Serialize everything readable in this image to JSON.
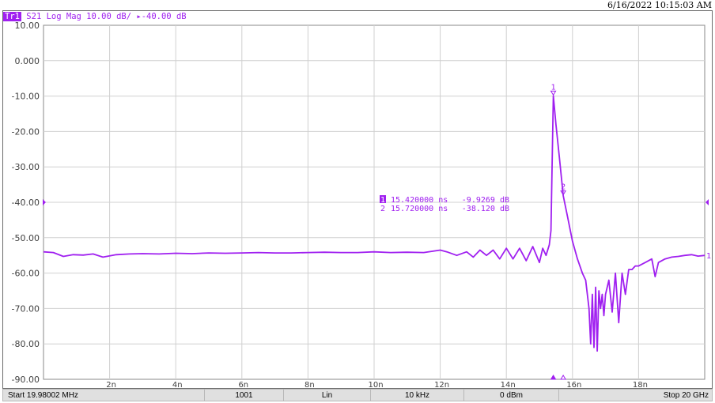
{
  "timestamp": "6/16/2022 10:15:03 AM",
  "trace": {
    "badge": "Tr1",
    "label": "S21 Log Mag 10.00 dB/ ▸-40.00 dB",
    "color": "#a020f0"
  },
  "status": {
    "start": "Start 19.98002 MHz",
    "points": "1001",
    "sweep_type": "Lin",
    "ifbw": "10 kHz",
    "power": "0 dBm",
    "stop": "Stop 20 GHz"
  },
  "markers": [
    {
      "id": "1",
      "x": 15.42,
      "y": -9.9269,
      "x_text": "15.420000 ns",
      "y_text": "-9.9269 dB",
      "active": true
    },
    {
      "id": "2",
      "x": 15.72,
      "y": -38.12,
      "x_text": "15.720000 ns",
      "y_text": "-38.120 dB",
      "active": false
    }
  ],
  "chart_data": {
    "type": "line",
    "title": "S21 Log Mag 10.00 dB/ ▸-40.00 dB",
    "xlabel": "",
    "ylabel": "",
    "xlim": [
      0,
      20
    ],
    "ylim": [
      -90,
      10
    ],
    "grid": true,
    "reference_level": -40,
    "y_ticks": [
      "10.00",
      "0.000",
      "-10.00",
      "-20.00",
      "-30.00",
      "-40.00",
      "-50.00",
      "-60.00",
      "-70.00",
      "-80.00",
      "-90.00"
    ],
    "x_ticks": [
      "2n",
      "4n",
      "6n",
      "8n",
      "10n",
      "12n",
      "14n",
      "16n",
      "18n"
    ],
    "x_tick_values": [
      2,
      4,
      6,
      8,
      10,
      12,
      14,
      16,
      18
    ],
    "series": [
      {
        "color": "#a020f0",
        "x": [
          0,
          0.3,
          0.6,
          0.9,
          1.2,
          1.5,
          1.8,
          2.2,
          2.6,
          3.0,
          3.5,
          4.0,
          4.5,
          5.0,
          5.5,
          6.0,
          6.5,
          7.0,
          7.5,
          8.0,
          8.5,
          9.0,
          9.5,
          10.0,
          10.5,
          11.0,
          11.5,
          12.0,
          12.2,
          12.5,
          12.8,
          13.0,
          13.2,
          13.4,
          13.6,
          13.8,
          14.0,
          14.2,
          14.4,
          14.6,
          14.8,
          15.0,
          15.1,
          15.2,
          15.3,
          15.35,
          15.42,
          15.5,
          15.6,
          15.72,
          15.85,
          16.0,
          16.15,
          16.3,
          16.4,
          16.5,
          16.55,
          16.6,
          16.65,
          16.7,
          16.75,
          16.8,
          16.85,
          16.9,
          16.95,
          17.0,
          17.1,
          17.2,
          17.3,
          17.4,
          17.5,
          17.6,
          17.7,
          17.8,
          17.9,
          18.0,
          18.2,
          18.4,
          18.5,
          18.6,
          18.8,
          19.0,
          19.2,
          19.4,
          19.6,
          19.8,
          20.0
        ],
        "y": [
          -54,
          -54.2,
          -55.3,
          -54.8,
          -54.9,
          -54.6,
          -55.5,
          -54.8,
          -54.6,
          -54.5,
          -54.6,
          -54.4,
          -54.5,
          -54.3,
          -54.4,
          -54.3,
          -54.2,
          -54.3,
          -54.3,
          -54.2,
          -54.1,
          -54.2,
          -54.2,
          -54.0,
          -54.2,
          -54.1,
          -54.2,
          -53.5,
          -54.0,
          -55.0,
          -54.0,
          -55.5,
          -53.5,
          -55.0,
          -53.5,
          -56.0,
          -53.0,
          -56.0,
          -53.0,
          -56.5,
          -52.5,
          -57.0,
          -53.0,
          -55.0,
          -52.0,
          -48.0,
          -9.9269,
          -18.0,
          -27.0,
          -38.12,
          -44.0,
          -51.0,
          -56.0,
          -60.0,
          -62.0,
          -70.0,
          -80.0,
          -66.0,
          -81.0,
          -64.0,
          -82.0,
          -65.0,
          -70.0,
          -66.0,
          -72.0,
          -66.0,
          -62.0,
          -71.0,
          -60.0,
          -74.0,
          -60.0,
          -66.0,
          -59.0,
          -59.0,
          -58.0,
          -58.0,
          -57.0,
          -56.0,
          -61.0,
          -57.0,
          -56.0,
          -55.5,
          -55.3,
          -55.0,
          -54.8,
          -55.2,
          -55.0
        ]
      }
    ]
  }
}
